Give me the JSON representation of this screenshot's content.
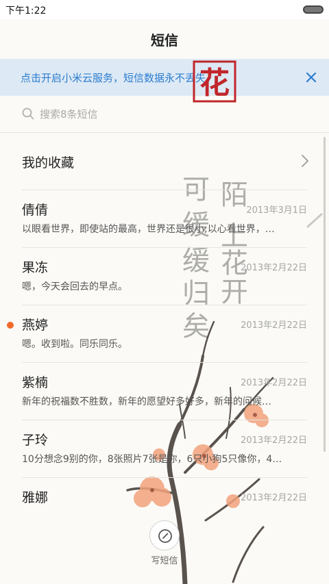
{
  "status_bar": {
    "time": "下午1:22"
  },
  "header": {
    "title": "短信"
  },
  "banner": {
    "text": "点击开启小米云服务，短信数据永不丢失。"
  },
  "search": {
    "placeholder": "搜索8条短信"
  },
  "favorites": {
    "label": "我的收藏"
  },
  "conversations": [
    {
      "name": "倩倩",
      "date": "2013年3月1日",
      "preview": "以眼看世界，即使站的最高，世界还是很小;以心看世界，…",
      "unread": false
    },
    {
      "name": "果冻",
      "date": "2013年2月22日",
      "preview": "嗯，今天会回去的早点。",
      "unread": false
    },
    {
      "name": "燕婷",
      "date": "2013年2月22日",
      "preview": "嗯。收到啦。同乐同乐。",
      "unread": true
    },
    {
      "name": "紫楠",
      "date": "2013年2月22日",
      "preview": "新年的祝福数不胜数，新年的愿望好多好多，新年的问候…",
      "unread": false
    },
    {
      "name": "子玲",
      "date": "2013年2月22日",
      "preview": "10分想念9别的你，8张照片7张是你，6只小狗5只像你，4…",
      "unread": false
    },
    {
      "name": "雅娜",
      "date": "2013年2月22日",
      "preview": "",
      "unread": false
    }
  ],
  "compose": {
    "label": "写短信"
  },
  "decor": {
    "calligraphy": [
      "陌",
      "上",
      "花",
      "开",
      "可",
      "缓",
      "缓",
      "归",
      "矣"
    ],
    "seal_text": "花",
    "colors": {
      "accent": "#2a7cd0",
      "banner_bg": "#dde9f4",
      "unread_dot": "#f06a2a",
      "seal_red": "#c0262b"
    }
  }
}
